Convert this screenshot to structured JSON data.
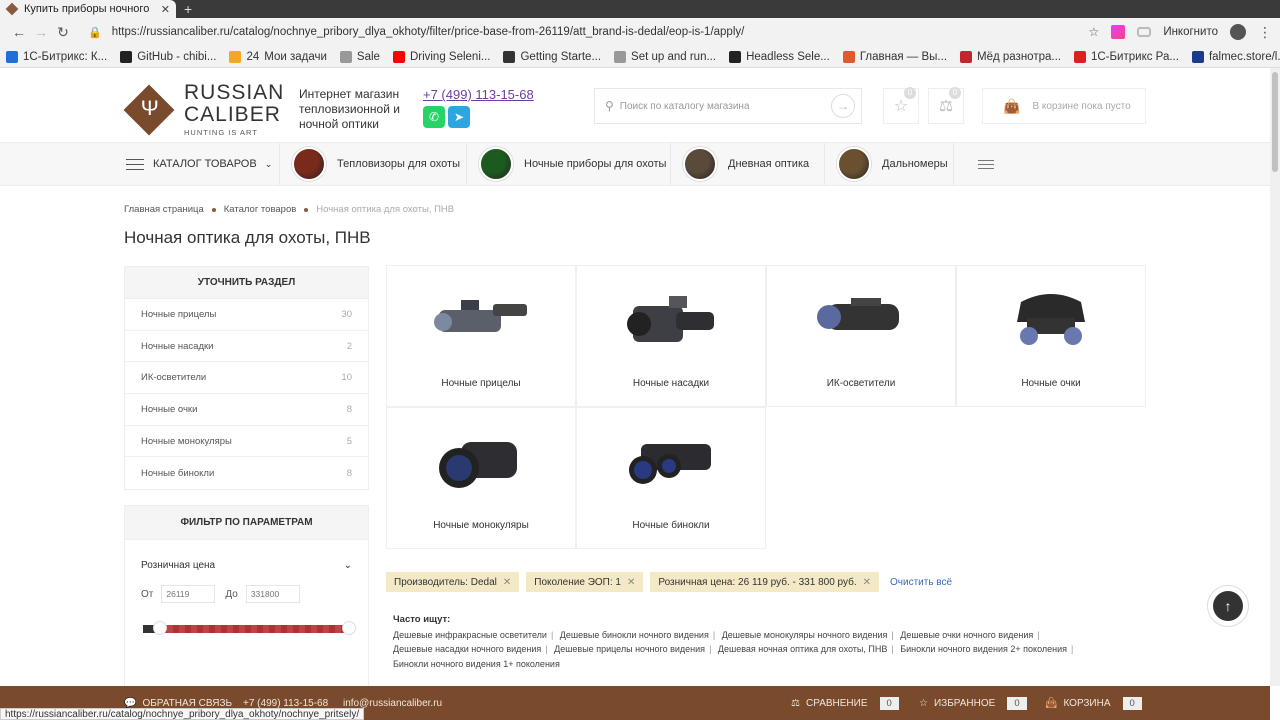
{
  "browser": {
    "tab_title": "Купить приборы ночного",
    "url": "https://russiancaliber.ru/catalog/nochnye_pribory_dlya_okhoty/filter/price-base-from-26119/att_brand-is-dedal/eop-is-1/apply/",
    "incognito_label": "Инкогнито",
    "bookmarks": [
      {
        "label": "1С-Битрикс: К...",
        "icon_color": "#1e6fd9"
      },
      {
        "label": "GitHub - chibi...",
        "icon_color": "#222222"
      },
      {
        "label": "Мои задачи",
        "prefix": "24",
        "icon_color": "#f5a623"
      },
      {
        "label": "Sale",
        "icon_color": "#999999"
      },
      {
        "label": "Driving Seleni...",
        "icon_color": "#ff0000"
      },
      {
        "label": "Getting Starte...",
        "icon_color": "#333333"
      },
      {
        "label": "Set up and run...",
        "icon_color": "#999999"
      },
      {
        "label": "Headless Sele...",
        "icon_color": "#222222"
      },
      {
        "label": "Главная — Вы...",
        "icon_color": "#e05a2b"
      },
      {
        "label": "Мёд разнотра...",
        "icon_color": "#c1272d"
      },
      {
        "label": "1С-Битрикс Ра...",
        "icon_color": "#e02020"
      },
      {
        "label": "falmec.store/l...",
        "icon_color": "#1a3a8a"
      }
    ],
    "status_url": "https://russiancaliber.ru/catalog/nochnye_pribory_dlya_okhoty/nochnye_pritsely/"
  },
  "header": {
    "logo_line1": "RUSSIAN",
    "logo_line2": "CALIBER",
    "logo_tag": "HUNTING IS ART",
    "shop_desc": "Интернет магазин тепловизионной и ночной оптики",
    "phone": "+7 (499) 113-15-68",
    "search_placeholder": "Поиск по каталогу магазина",
    "favorites_count": "0",
    "compare_count": "0",
    "cart_text": "В корзине пока пусто"
  },
  "nav": {
    "catalog_label": "Каталог товаров",
    "items": [
      {
        "label": "Тепловизоры для охоты",
        "color": "#7a2a1a"
      },
      {
        "label": "Ночные приборы для охоты",
        "color": "#1d5a1d"
      },
      {
        "label": "Дневная оптика",
        "color": "#5a4a3a"
      },
      {
        "label": "Дальномеры",
        "color": "#6a5030"
      }
    ]
  },
  "breadcrumbs": [
    "Главная страница",
    "Каталог товаров",
    "Ночная оптика для охоты, ПНВ"
  ],
  "page_title": "Ночная оптика для охоты, ПНВ",
  "sidebar": {
    "title": "Уточнить раздел",
    "items": [
      {
        "label": "Ночные прицелы",
        "count": "30"
      },
      {
        "label": "Ночные насадки",
        "count": "2"
      },
      {
        "label": "ИК-осветители",
        "count": "10"
      },
      {
        "label": "Ночные очки",
        "count": "8"
      },
      {
        "label": "Ночные монокуляры",
        "count": "5"
      },
      {
        "label": "Ночные бинокли",
        "count": "8"
      }
    ]
  },
  "filter": {
    "title": "Фильтр по параметрам",
    "price_title": "Розничная цена",
    "from_label": "От",
    "to_label": "До",
    "from_placeholder": "26119",
    "to_placeholder": "331800"
  },
  "categories": [
    {
      "label": "Ночные прицелы"
    },
    {
      "label": "Ночные насадки"
    },
    {
      "label": "ИК-осветители"
    },
    {
      "label": "Ночные очки"
    },
    {
      "label": "Ночные монокуляры"
    },
    {
      "label": "Ночные бинокли"
    }
  ],
  "chips": [
    {
      "label": "Производитель: Dedal"
    },
    {
      "label": "Поколение ЭОП: 1"
    },
    {
      "label": "Розничная цена: 26 119 руб. - 331 800 руб."
    }
  ],
  "clear_all": "Очистить всё",
  "often": {
    "title": "Часто ищут:",
    "links": [
      "Дешевые инфракрасные осветители",
      "Дешевые бинокли ночного видения",
      "Дешевые монокуляры ночного видения",
      "Дешевые очки ночного видения",
      "Дешевые насадки ночного видения",
      "Дешевые прицелы ночного видения",
      "Дешевая ночная оптика для охоты, ПНВ",
      "Бинокли ночного видения 2+ поколения",
      "Бинокли ночного видения 1+ поколения"
    ]
  },
  "footer": {
    "feedback": "Обратная связь",
    "phone": "+7 (499) 113-15-68",
    "email": "info@russiancaliber.ru",
    "compare_label": "Сравнение",
    "compare_count": "0",
    "favorites_label": "Избранное",
    "favorites_count": "0",
    "cart_label": "Корзина",
    "cart_count": "0"
  }
}
